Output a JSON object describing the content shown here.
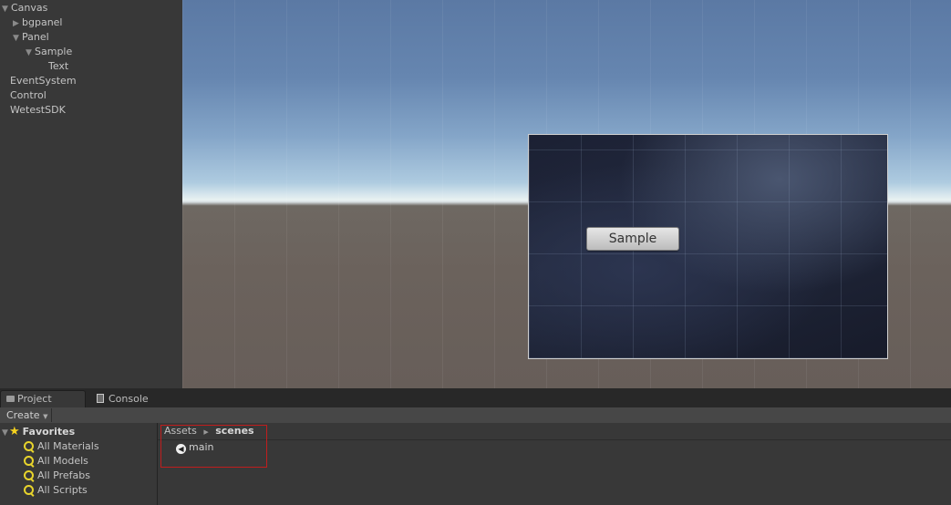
{
  "hierarchy": {
    "items": [
      {
        "label": "Canvas",
        "expanded": true
      },
      {
        "label": "bgpanel",
        "expanded": false
      },
      {
        "label": "Panel",
        "expanded": true
      },
      {
        "label": "Sample",
        "expanded": true
      },
      {
        "label": "Text"
      },
      {
        "label": "EventSystem"
      },
      {
        "label": "Control"
      },
      {
        "label": "WetestSDK"
      }
    ]
  },
  "scene": {
    "button_label": "Sample"
  },
  "project": {
    "tabs": [
      {
        "label": "Project",
        "icon": "folder-icon",
        "active": true
      },
      {
        "label": "Console",
        "icon": "console-icon",
        "active": false
      }
    ],
    "create_label": "Create",
    "favorites": {
      "label": "Favorites",
      "items": [
        "All Materials",
        "All Models",
        "All Prefabs",
        "All Scripts"
      ]
    },
    "breadcrumb": [
      "Assets",
      "scenes"
    ],
    "assets": [
      {
        "name": "main",
        "icon": "unity-scene-icon"
      }
    ]
  },
  "colors": {
    "highlight": "#c01d1d",
    "favorite_star": "#f5d21e",
    "search_icon": "#e8d42c"
  }
}
